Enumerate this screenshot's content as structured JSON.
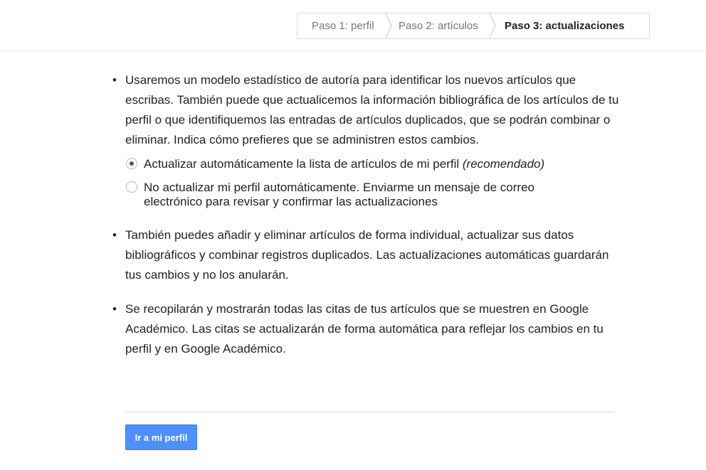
{
  "steps": [
    {
      "label": "Paso 1: perfil"
    },
    {
      "label": "Paso 2: artículos"
    },
    {
      "label": "Paso 3: actualizaciones"
    }
  ],
  "bullet_char": "•",
  "paragraphs": {
    "p1": "Usaremos un modelo estadístico de autoría para identificar los nuevos artículos que escribas. También puede que actualicemos la información bibliográfica de los artículos de tu perfil o que identifiquemos las entradas de artículos duplicados, que se podrán combinar o eliminar. Indica cómo prefieres que se administren estos cambios.",
    "p2": "También puedes añadir y eliminar artículos de forma individual, actualizar sus datos bibliográficos y combinar registros duplicados. Las actualizaciones automáticas guardarán tus cambios y no los anularán.",
    "p3": "Se recopilarán y mostrarán todas las citas de tus artículos que se muestren en Google Académico. Las citas se actualizarán de forma automática para reflejar los cambios en tu perfil y en Google Académico."
  },
  "options": {
    "auto_label": "Actualizar automáticamente la lista de artículos de mi perfil",
    "auto_note": "(recomendado)",
    "auto_selected": true,
    "manual_line1": "No actualizar mi perfil automáticamente. Enviarme un mensaje de correo",
    "manual_line2": "electrónico para revisar y confirmar las actualizaciones",
    "manual_selected": false
  },
  "button": {
    "label": "Ir a mi perfil"
  },
  "colors": {
    "button_bg": "#4d90fe",
    "button_border": "#3079ed"
  }
}
